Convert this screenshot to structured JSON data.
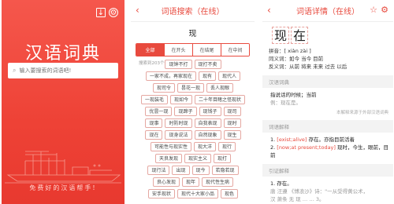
{
  "home": {
    "title": "汉语词典",
    "search_placeholder": "输入要搜索的词语吧!",
    "slogan": "免费好的汉语帮手!"
  },
  "search": {
    "header": "词语搜索（在线）",
    "query_char": "现",
    "tabs": [
      {
        "label": "全部",
        "active": true
      },
      {
        "label": "在开头",
        "active": false
      },
      {
        "label": "在结尾",
        "active": false
      },
      {
        "label": "在中间",
        "active": false
      }
    ],
    "count_text": "搜索到203个词",
    "rows": [
      [
        "现钟不打",
        "现打不卖"
      ],
      [
        "一家不成，再家现在",
        "现有",
        "现代人"
      ],
      [
        "现司令",
        "昙花一现",
        "丢人现眼"
      ],
      [
        "一现装毛",
        "现如今",
        "二十年目睹之怪现状"
      ],
      [
        "优昙一现",
        "现蹄子",
        "现钱子",
        "现司"
      ],
      [
        "现事",
        "时防时现",
        "自我表现",
        "现时"
      ],
      [
        "现在",
        "现身说法",
        "自然现象",
        "现生"
      ],
      [
        "可能性与现实性",
        "现大洋",
        "现行"
      ],
      [
        "天良发现",
        "现实主义",
        "现打"
      ],
      [
        "现行法",
        "出现",
        "现今",
        "若隐若现"
      ],
      [
        "良心发现",
        "现年",
        "现代性生病"
      ],
      [
        "安手现状",
        "现代十大家小品",
        "现色"
      ]
    ]
  },
  "detail": {
    "header": "词语详情（在线）",
    "chars": [
      "现",
      "在"
    ],
    "pinyin": "拼音：[ xiàn zài ]",
    "synonyms": "同义词：如今 当今 目前",
    "antonyms": "反义词：从前 将来 未来 过去 以后",
    "section_hanyu": "汉语词典",
    "hanyu_def": "指说话的时候；当前",
    "hanyu_example": "例：现在是。",
    "source_note": "本解释来源于外部汉语词典",
    "section_cidian": "词语解释",
    "cidian_lines": [
      {
        "num": "1.",
        "en": "[exist;alive]",
        "zh": "存在。亦指目前活着"
      },
      {
        "num": "2.",
        "en": "[now;at present;today]",
        "zh": "现时，今生，眼前，目前"
      }
    ],
    "section_yinzheng": "引证解释",
    "yinzheng_lines": [
      "1. 存在。",
      "唐 汪遵 《博浪沙》诗：\"一从受得黄公术，",
      "汉 萧条 无 现 … … 3。"
    ]
  }
}
